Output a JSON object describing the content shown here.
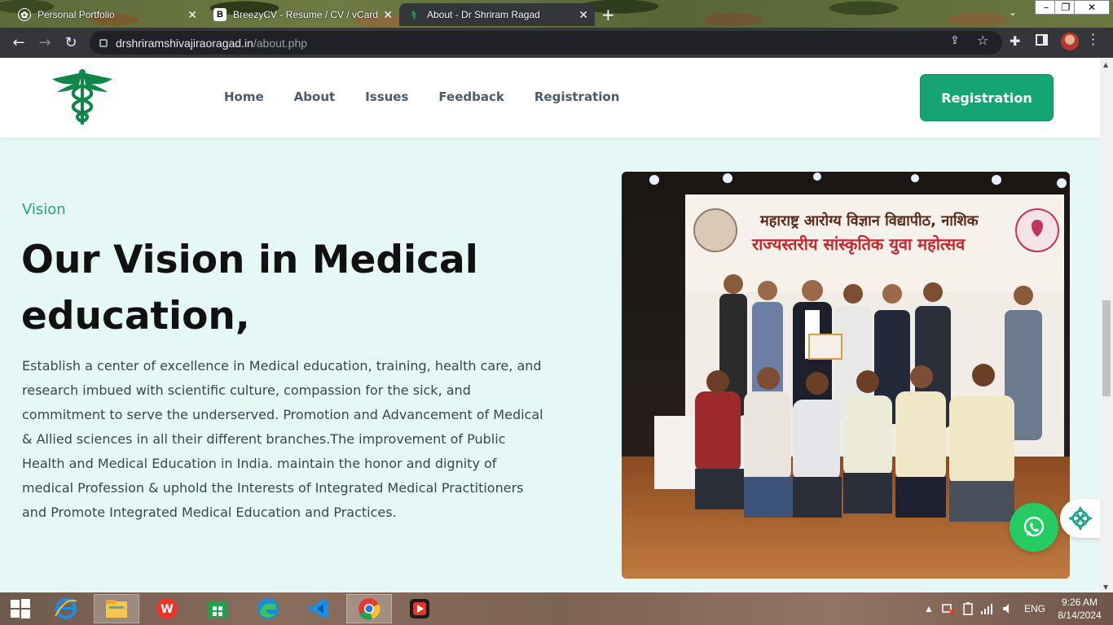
{
  "browser": {
    "tabs": [
      {
        "title": "Personal Portfolio",
        "active": false
      },
      {
        "title": "BreezyCV - Resume / CV / vCard",
        "active": false
      },
      {
        "title": "About - Dr Shriram Ragad",
        "active": true
      }
    ],
    "url_host": "drshriramshivajiraoragad.in",
    "url_path": "/about.php"
  },
  "header": {
    "nav": [
      "Home",
      "About",
      "Issues",
      "Feedback",
      "Registration"
    ],
    "cta_label": "Registration"
  },
  "vision": {
    "eyebrow": "Vision",
    "title": "Our Vision in Medical education,",
    "body": "Establish a center of excellence in Medical education, training, health care, and research imbued with scientific culture, compassion for the sick, and commitment to serve the underserved. Promotion and Advancement of Medical & Allied sciences in all their different branches.The improvement of Public Health and Medical Education in India. maintain the honor and dignity of medical Profession & uphold the Interests of Integrated Medical Practitioners and Promote Integrated Medical Education and Practices."
  },
  "photo": {
    "banner_line1": "महाराष्ट्र आरोग्य विज्ञान विद्यापीठ, नाशिक",
    "banner_line2": "राज्यस्तरीय सांस्कृतिक युवा महोत्सव"
  },
  "taskbar": {
    "lang": "ENG",
    "time": "9:26 AM",
    "date": "8/14/2024"
  },
  "colors": {
    "accent": "#15a474",
    "page_bg": "#e6f8f5",
    "chrome_dark": "#35363a"
  },
  "icons": [
    "back-icon",
    "forward-icon",
    "reload-icon",
    "lock-icon",
    "share-icon",
    "star-icon",
    "extensions-icon",
    "sidepanel-icon",
    "menu-icon",
    "whatsapp-icon",
    "ai-assistant-icon",
    "windows-start-icon"
  ]
}
